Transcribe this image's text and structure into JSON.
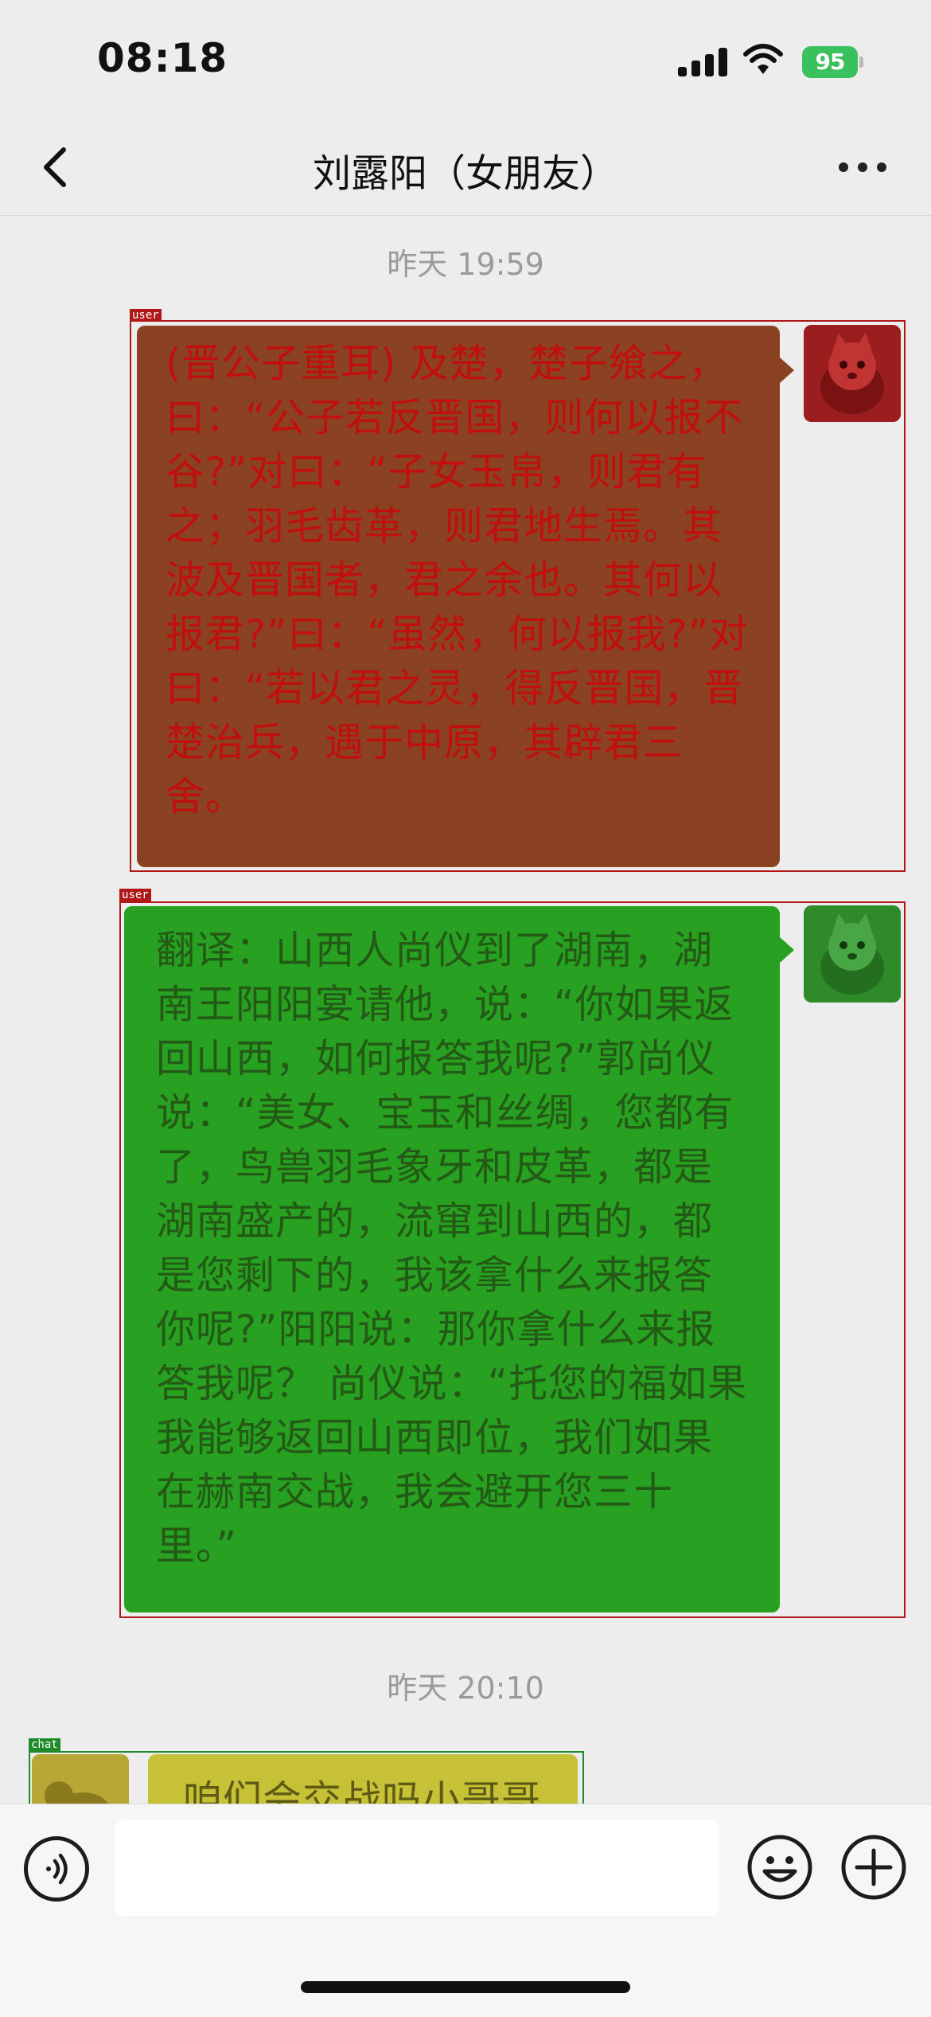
{
  "status_bar": {
    "time": "08:18",
    "battery_level": "95"
  },
  "nav": {
    "title": "刘露阳（女朋友）"
  },
  "chat": {
    "messages": [
      {
        "type": "timestamp",
        "text": "昨天 19:59"
      },
      {
        "type": "outgoing",
        "tag": "user",
        "bubble_color": "#8b4222",
        "text_color": "#c10e0e",
        "text": "(晋公子重耳) 及楚，楚子飨之，曰：“公子若反晋国，则何以报不谷?”对曰：“子女玉帛，则君有之；羽毛齿革，则君地生焉。其波及晋国者，君之余也。其何以报君?”曰：“虽然，何以报我?”对曰：“若以君之灵，得反晋国，晋楚治兵，遇于中原，其辟君三舍。"
      },
      {
        "type": "outgoing",
        "tag": "user",
        "bubble_color": "#28a021",
        "text_color": "#235a16",
        "text": "翻译：山西人尚仪到了湖南，湖南王阳阳宴请他，说：“你如果返回山西，如何报答我呢?”郭尚仪说：“美女、宝玉和丝绸，您都有了，鸟兽羽毛象牙和皮革，都是湖南盛产的，流窜到山西的，都是您剩下的，我该拿什么来报答你呢?”阳阳说：那你拿什么来报答我呢？ 尚仪说：“托您的福如果我能够返回山西即位，我们如果在赫南交战，我会避开您三十里。”"
      },
      {
        "type": "timestamp",
        "text": "昨天 20:10"
      },
      {
        "type": "incoming",
        "tag": "chat",
        "text": "咱们会交战吗小哥哥"
      }
    ]
  },
  "input_bar": {
    "input_value": ""
  }
}
